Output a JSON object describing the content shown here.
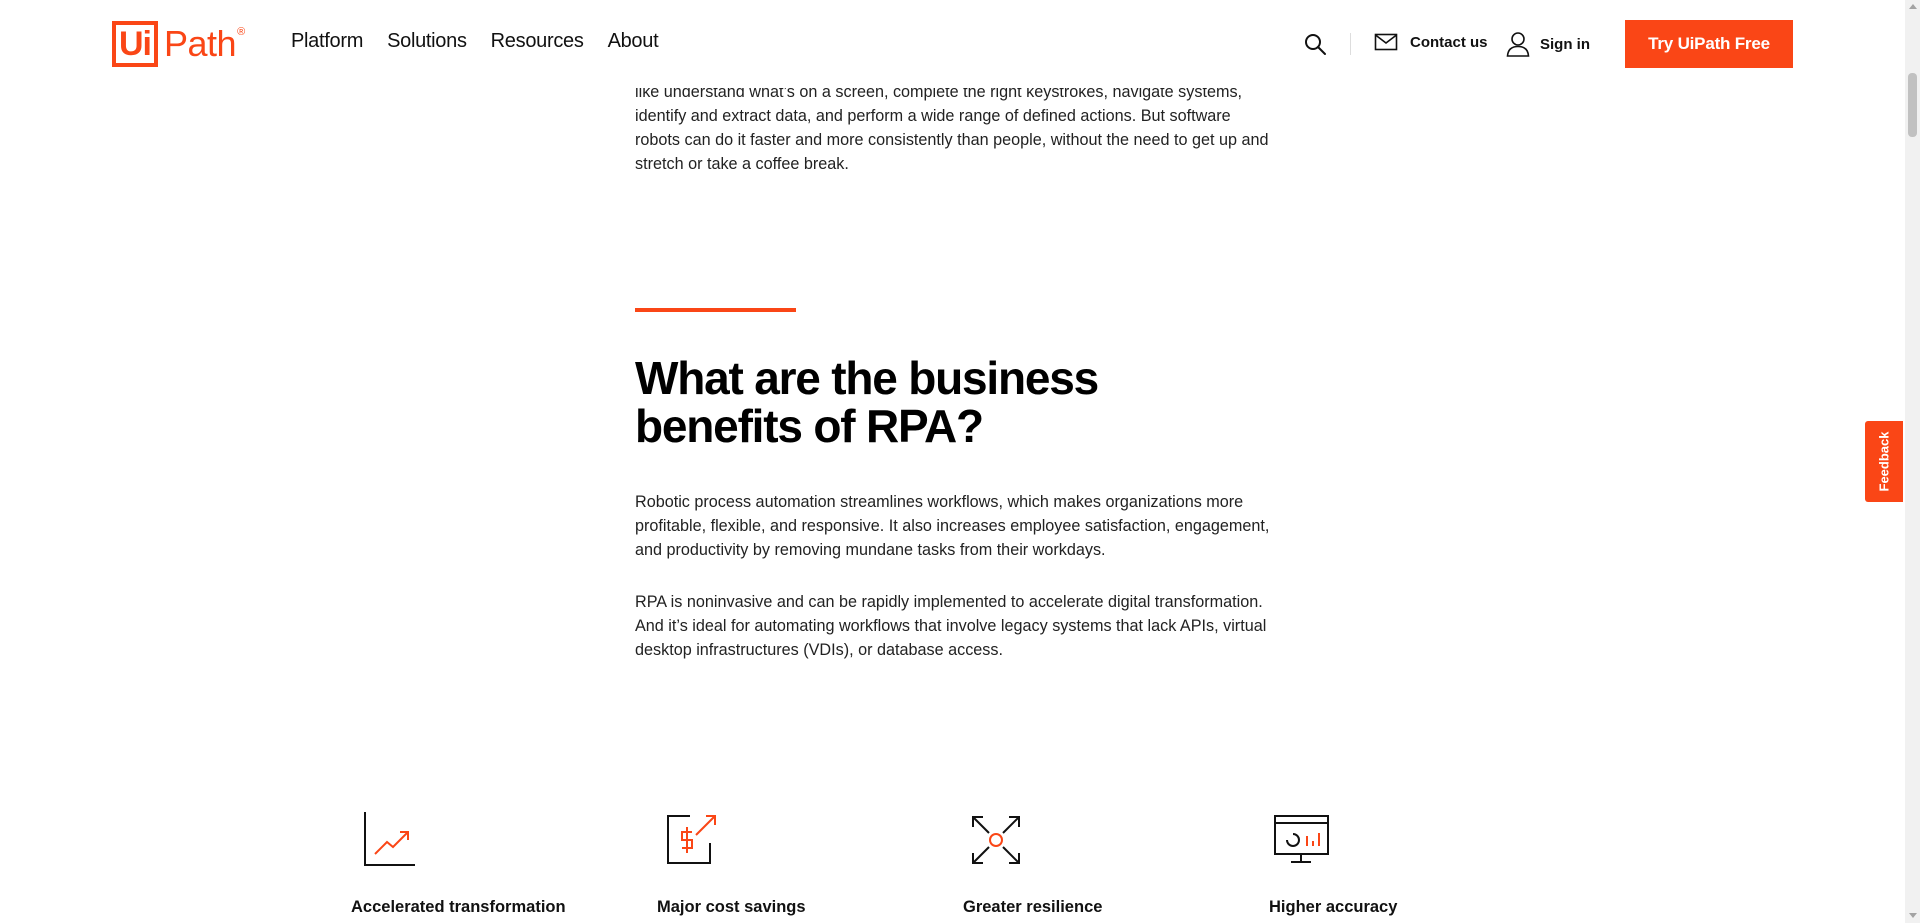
{
  "nav": {
    "logo": {
      "mark": "Ui",
      "text": "Path",
      "reg": "®"
    },
    "menu": [
      "Platform",
      "Solutions",
      "Resources",
      "About"
    ],
    "contact_label": "Contact us",
    "signin_label": "Sign in",
    "cta_label": "Try UiPath Free",
    "icons": {
      "search": "search-icon",
      "contact": "envelope-icon",
      "signin": "user-icon"
    }
  },
  "intro": {
    "text": "like understand what’s on a screen, complete the right keystrokes, navigate systems, identify and extract data, and perform a wide range of defined actions. But software robots can do it faster and more consistently than people, without the need to get up and stretch or take a coffee break."
  },
  "section": {
    "heading": "What are the business benefits of RPA?",
    "p1": "Robotic process automation streamlines workflows, which makes organizations more profitable, flexible, and responsive. It also increases employee satisfaction, engagement, and productivity by removing mundane tasks from their workdays.",
    "p2": "RPA is noninvasive and can be rapidly implemented to accelerate digital transformation. And it’s ideal for automating workflows that involve legacy systems that lack APIs, virtual desktop infrastructures (VDIs), or database access."
  },
  "benefits": [
    {
      "label": "Accelerated transformation",
      "icon": "trend-chart-icon"
    },
    {
      "label": "Major cost savings",
      "icon": "dollar-arrow-icon"
    },
    {
      "label": "Greater resilience",
      "icon": "expand-arrows-icon"
    },
    {
      "label": "Higher accuracy",
      "icon": "monitor-dashboard-icon"
    }
  ],
  "feedback_label": "Feedback",
  "colors": {
    "accent": "#fa4616",
    "text": "#222222"
  }
}
